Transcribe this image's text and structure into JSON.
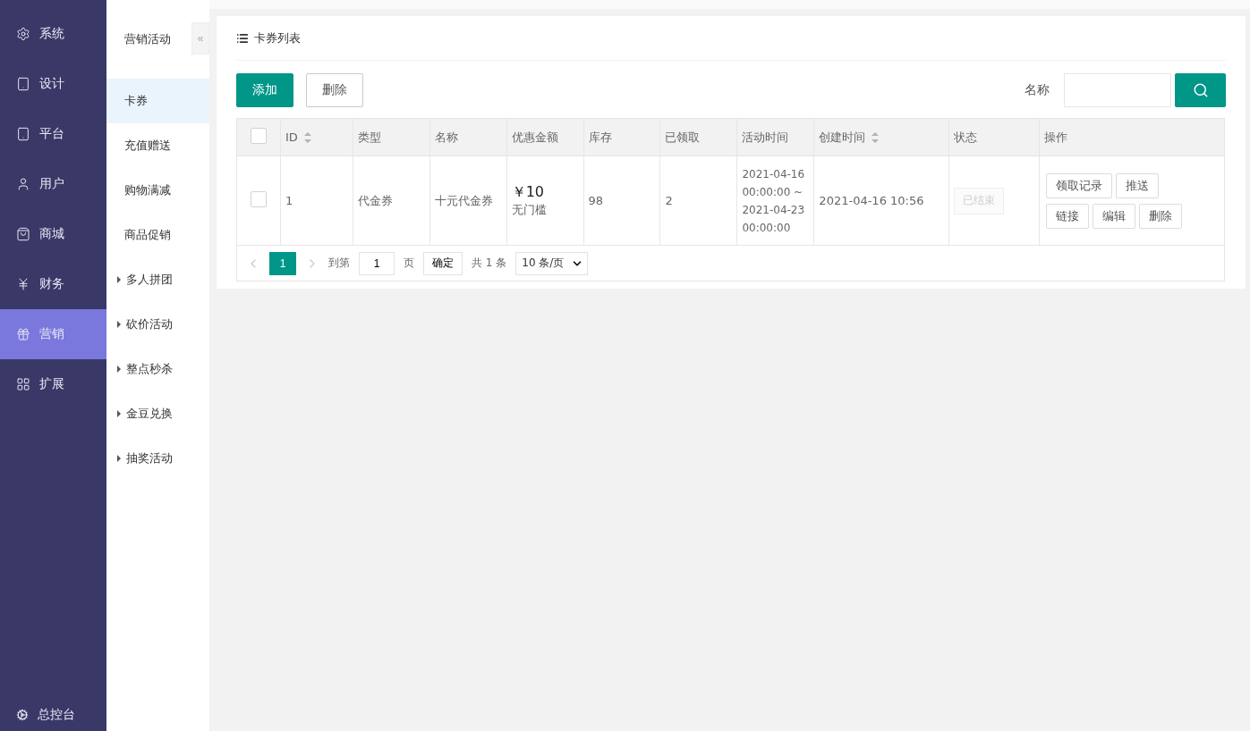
{
  "nav": {
    "items": [
      {
        "label": "系统",
        "selected": false
      },
      {
        "label": "设计",
        "selected": false
      },
      {
        "label": "平台",
        "selected": false
      },
      {
        "label": "用户",
        "selected": false
      },
      {
        "label": "商城",
        "selected": false
      },
      {
        "label": "财务",
        "selected": false
      },
      {
        "label": "营销",
        "selected": true
      },
      {
        "label": "扩展",
        "selected": false
      }
    ],
    "footer": {
      "label": "总控台"
    }
  },
  "subnav": {
    "title": "营销活动",
    "collapse": "«",
    "items": [
      {
        "label": "卡券",
        "kind": "link",
        "selected": true
      },
      {
        "label": "充值赠送",
        "kind": "link",
        "selected": false
      },
      {
        "label": "购物满减",
        "kind": "link",
        "selected": false
      },
      {
        "label": "商品促销",
        "kind": "link",
        "selected": false
      },
      {
        "label": "多人拼团",
        "kind": "group",
        "selected": false
      },
      {
        "label": "砍价活动",
        "kind": "group",
        "selected": false
      },
      {
        "label": "整点秒杀",
        "kind": "group",
        "selected": false
      },
      {
        "label": "金豆兑换",
        "kind": "group",
        "selected": false
      },
      {
        "label": "抽奖活动",
        "kind": "group",
        "selected": false
      }
    ]
  },
  "card": {
    "title": "卡券列表",
    "toolbar": {
      "add": "添加",
      "delete": "删除",
      "search_label": "名称"
    },
    "table": {
      "select_all": {
        "checked": false
      },
      "columns": [
        {
          "label": "ID",
          "sortable": true
        },
        {
          "label": "类型",
          "sortable": false
        },
        {
          "label": "名称",
          "sortable": false
        },
        {
          "label": "优惠金额",
          "sortable": false
        },
        {
          "label": "库存",
          "sortable": false
        },
        {
          "label": "已领取",
          "sortable": false
        },
        {
          "label": "活动时间",
          "sortable": false
        },
        {
          "label": "创建时间",
          "sortable": true
        },
        {
          "label": "状态",
          "sortable": false
        },
        {
          "label": "操作",
          "sortable": false
        }
      ],
      "rows": [
        {
          "checked": false,
          "id": "1",
          "type": "代金券",
          "name": "十元代金券",
          "amount": "￥10",
          "threshold": "无门槛",
          "stock": "98",
          "claimed": "2",
          "period": [
            "2021-04-16",
            "00:00:00 ~",
            "2021-04-23",
            "00:00:00"
          ],
          "created": "2021-04-16 10:56",
          "status": {
            "label": "已结束",
            "disabled": true
          },
          "actions": [
            [
              "领取记录",
              "推送"
            ],
            [
              "链接",
              "编辑",
              "删除"
            ]
          ]
        }
      ]
    },
    "pagination": {
      "pages": [
        {
          "label": "1",
          "selected": true
        }
      ],
      "goto": "到第",
      "page_value": "1",
      "page_unit": "页",
      "confirm": "确定",
      "total": "共 1 条",
      "page_size": "10 条/页"
    }
  }
}
